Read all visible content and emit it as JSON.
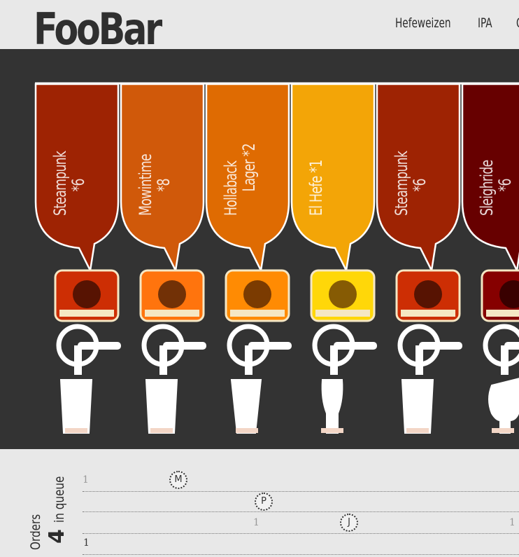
{
  "header": {
    "logo": "FooBar",
    "nav": [
      {
        "label": "Hefeweizen"
      },
      {
        "label": "IPA"
      },
      {
        "label": "C"
      }
    ]
  },
  "taps": [
    {
      "name": "Steampunk",
      "count": "*6",
      "color": "#9e2303",
      "label_icon": "steampunk-label-icon",
      "glass": "pint"
    },
    {
      "name": "Mowintime",
      "count": "*8",
      "color": "#d0590a",
      "label_icon": "mowintime-label-icon",
      "glass": "pint"
    },
    {
      "name": "Hollaback",
      "count": "Lager *2",
      "color": "#df6b02",
      "label_icon": "hollaback-label-icon",
      "glass": "pilsner"
    },
    {
      "name": "El Hefe *1",
      "count": "",
      "color": "#f3a507",
      "label_icon": "elhefe-label-icon",
      "glass": "weizen"
    },
    {
      "name": "Steampunk",
      "count": "*6",
      "color": "#9e2303",
      "label_icon": "steampunk-label-icon",
      "glass": "pint"
    },
    {
      "name": "Sleighride",
      "count": "*6",
      "color": "#670000",
      "label_icon": "sleighride-label-icon",
      "glass": "tulip"
    }
  ],
  "orders": {
    "title": "Orders",
    "count": "4",
    "suffix": "in queue",
    "lanes": [
      {
        "markers": [
          "1"
        ],
        "badge": "M"
      },
      {
        "markers": [],
        "badge": "P"
      },
      {
        "markers": [
          "1",
          "1"
        ],
        "badge": "J"
      },
      {
        "markers": [
          "1"
        ],
        "badge": ""
      }
    ]
  }
}
